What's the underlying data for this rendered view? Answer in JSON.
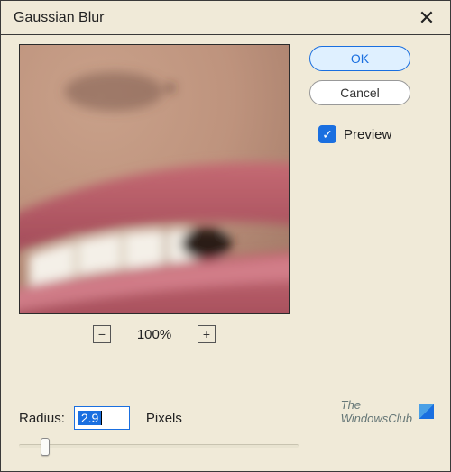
{
  "dialog": {
    "title": "Gaussian Blur",
    "close_symbol": "✕"
  },
  "buttons": {
    "ok": "OK",
    "cancel": "Cancel"
  },
  "preview_checkbox": {
    "checked": true,
    "label": "Preview",
    "check_symbol": "✓"
  },
  "zoom": {
    "level": "100%",
    "minus": "−",
    "plus": "+"
  },
  "radius": {
    "label": "Radius:",
    "value": "2.9",
    "unit": "Pixels",
    "slider_position_pct": 7
  },
  "watermark": {
    "line1": "The",
    "line2": "WindowsClub"
  },
  "colors": {
    "accent": "#1a6fe0",
    "panel_bg": "#f0ead8"
  }
}
